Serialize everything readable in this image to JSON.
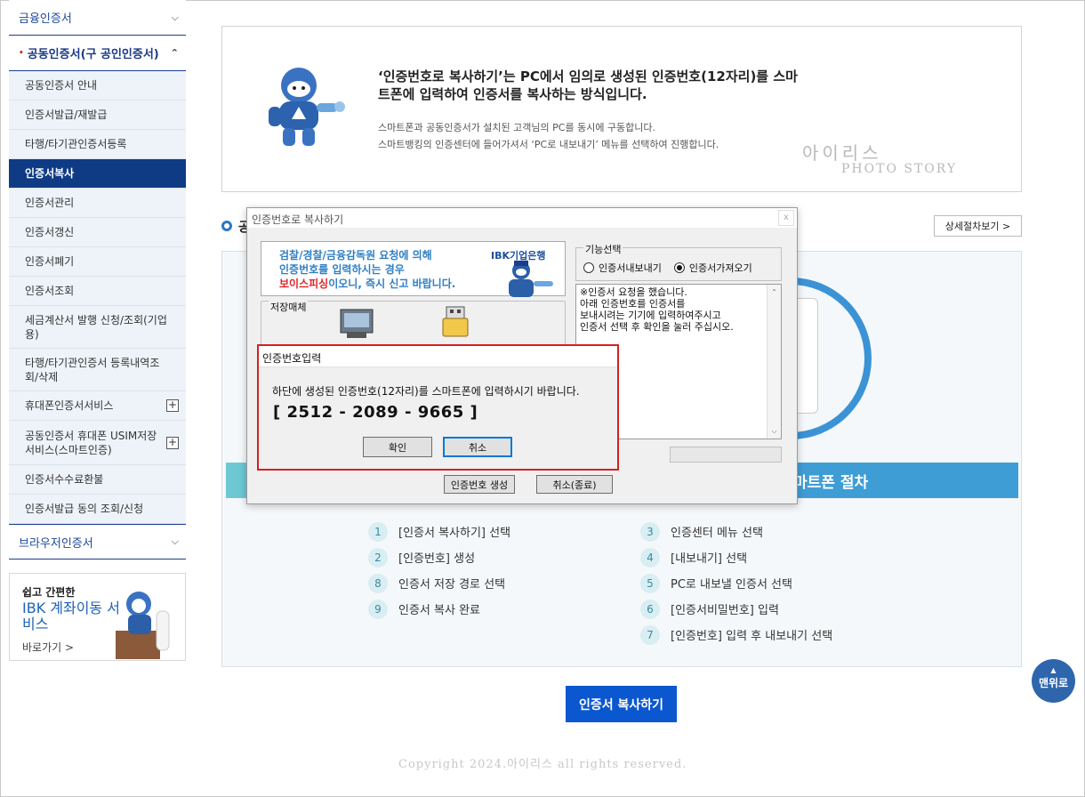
{
  "sidebar": {
    "menu1": "금융인증서",
    "menu2": "공동인증서(구 공인인증서)",
    "items": [
      "공동인증서 안내",
      "인증서발급/재발급",
      "타행/타기관인증서등록",
      "인증서복사",
      "인증서관리",
      "인증서갱신",
      "인증서폐기",
      "인증서조회",
      "세금계산서 발행 신청/조회(기업용)",
      "타행/타기관인증서 등록내역조회/삭제",
      "휴대폰인증서서비스",
      "공동인증서 휴대폰 USIM저장서비스(스마트인증)",
      "인증서수수료환불",
      "인증서발급 동의 조회/신청"
    ],
    "menu3": "브라우저인증서",
    "banner": {
      "line1": "쉽고 간편한",
      "line2": "IBK 계좌이동 서비스",
      "link": "바로가기 >"
    }
  },
  "info": {
    "headline": "‘인증번호로 복사하기’는 PC에서 임의로 생성된 인증번호(12자리)를 스마트폰에 입력하여 인증서를 복사하는 방식입니다.",
    "desc1": "스마트폰과 공동인증서가 설치된 고객님의 PC를 동시에 구동합니다.",
    "desc2": "스마트뱅킹의 인증센터에 들어가셔서 ‘PC로 내보내기’ 메뉴를 선택하여 진행합니다.",
    "watermark1": "아이리스",
    "watermark2": "PHOTO STORY"
  },
  "section": {
    "title_partial": "공",
    "detail_button": "상세절차보기 >"
  },
  "procedure": {
    "smartphone_bar": "마트폰 절차",
    "left_steps": [
      {
        "n": "1",
        "text": "[인증서 복사하기] 선택"
      },
      {
        "n": "2",
        "text": "[인증번호] 생성"
      },
      {
        "n": "8",
        "text": "인증서 저장 경로 선택"
      },
      {
        "n": "9",
        "text": "인증서 복사 완료"
      }
    ],
    "right_steps": [
      {
        "n": "3",
        "text": "인증센터 메뉴 선택"
      },
      {
        "n": "4",
        "text": "[내보내기] 선택"
      },
      {
        "n": "5",
        "text": "PC로 내보낼 인증서 선택"
      },
      {
        "n": "6",
        "text": "[인증서비밀번호] 입력"
      },
      {
        "n": "7",
        "text": "[인증번호] 입력 후 내보내기 선택"
      }
    ]
  },
  "copy_button": "인증서 복사하기",
  "copyright": "Copyright 2024.아이리스 all rights reserved.",
  "top_button": "맨위로",
  "dialog": {
    "title": "인증번호로 복사하기",
    "close": "x",
    "ad_line1": "검찰/경찰/금융감독원 요청에 의해",
    "ad_line2": "인증번호를 입력하시는 경우",
    "ad_line3_red": "보이스피싱",
    "ad_line3_rest": "이오니, 즉시 신고 바랍니다.",
    "ad_logo": "IBK기업은행",
    "storage_label": "저장매체",
    "func_label": "기능선택",
    "radio_export": "인증서내보내기",
    "radio_import": "인증서가져오기",
    "message": "※인증서 요청을 했습니다.\n아래 인증번호를 인증서를\n보내시려는 기기에 입력하여주시고\n인증서 선택 후 확인을 눌러 주십시오.",
    "gen_button": "인증번호 생성",
    "cancel_end_button": "취소(종료)"
  },
  "code_dialog": {
    "title": "인증번호입력",
    "message": "하단에 생성된 인증번호(12자리)를 스마트폰에 입력하시기 바랍니다.",
    "code": "[ 2512 - 2089 - 9665 ]",
    "ok": "확인",
    "cancel": "취소"
  },
  "colors": {
    "navy": "#0f3b84",
    "accent_blue": "#3f9dd6",
    "teal": "#6cc9d4",
    "button_blue": "#0b57d0",
    "alert_red": "#d42020"
  }
}
